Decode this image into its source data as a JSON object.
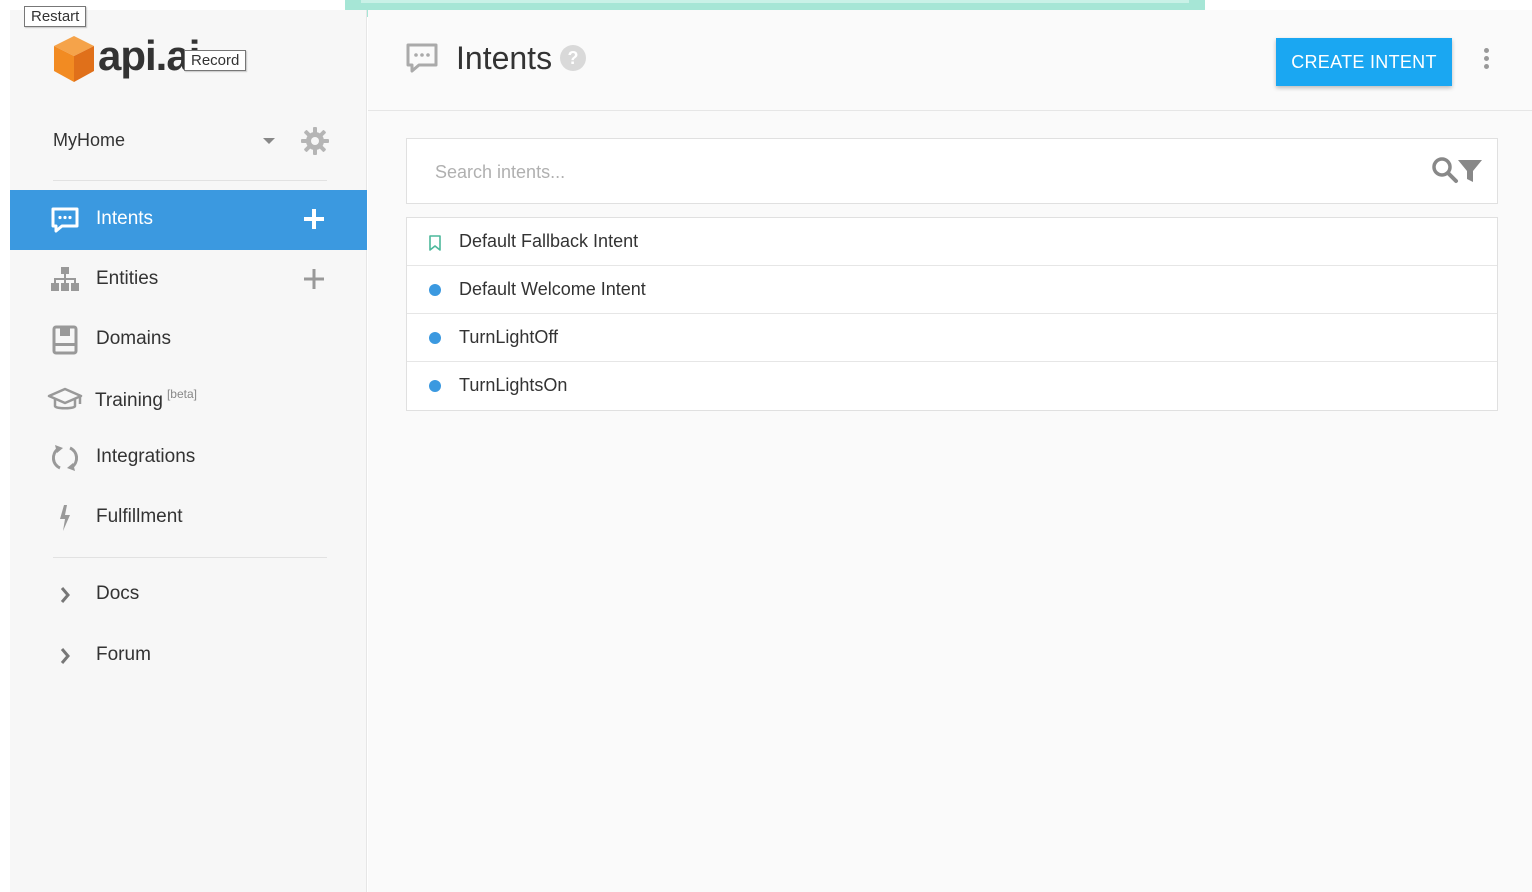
{
  "overlay": {
    "restart_label": "Restart",
    "record_label": "Record"
  },
  "logo": {
    "text": "api.ai",
    "brand_color": "#f28b22"
  },
  "agent": {
    "name": "MyHome"
  },
  "sidebar": {
    "items": [
      {
        "label": "Intents",
        "icon": "chat-bubble-icon",
        "active": true,
        "has_add": true
      },
      {
        "label": "Entities",
        "icon": "hierarchy-icon",
        "active": false,
        "has_add": true
      },
      {
        "label": "Domains",
        "icon": "book-icon",
        "active": false,
        "has_add": false
      },
      {
        "label": "Training",
        "badge": "[beta]",
        "icon": "graduation-cap-icon",
        "active": false,
        "has_add": false
      },
      {
        "label": "Integrations",
        "icon": "refresh-icon",
        "active": false,
        "has_add": false
      },
      {
        "label": "Fulfillment",
        "icon": "lightning-icon",
        "active": false,
        "has_add": false
      }
    ],
    "links": [
      {
        "label": "Docs",
        "icon": "chevron-right-icon"
      },
      {
        "label": "Forum",
        "icon": "chevron-right-icon"
      }
    ],
    "active_color": "#3b99e0"
  },
  "header": {
    "title": "Intents",
    "help": "?",
    "create_button": "CREATE INTENT",
    "button_color": "#1aa7f2"
  },
  "search": {
    "placeholder": "Search intents...",
    "value": ""
  },
  "intents": [
    {
      "name": "Default Fallback Intent",
      "marker": "bookmark-icon"
    },
    {
      "name": "Default Welcome Intent",
      "marker": "dot"
    },
    {
      "name": "TurnLightOff",
      "marker": "dot"
    },
    {
      "name": "TurnLightsOn",
      "marker": "dot"
    }
  ]
}
